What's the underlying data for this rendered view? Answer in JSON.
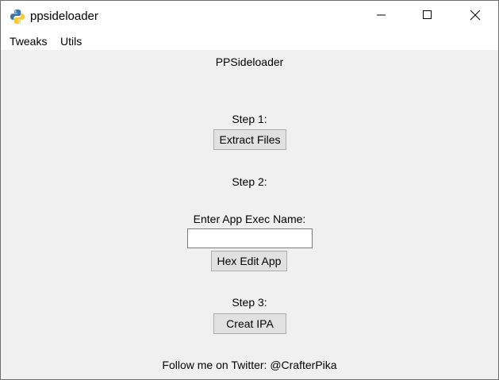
{
  "window": {
    "title": "ppsideloader"
  },
  "menu": {
    "items": [
      {
        "label": "Tweaks"
      },
      {
        "label": "Utils"
      }
    ]
  },
  "main": {
    "app_label": "PPSideloader",
    "step1_label": "Step 1:",
    "extract_button": "Extract Files",
    "step2_label": "Step 2:",
    "enter_label": "Enter App Exec Name:",
    "exec_name_value": "",
    "hex_button": "Hex Edit App",
    "step3_label": "Step 3:",
    "ipa_button": "Creat IPA",
    "follow_text": "Follow me on Twitter: @CrafterPika"
  },
  "icons": {
    "app": "python-icon",
    "minimize": "minimize-icon",
    "maximize": "maximize-icon",
    "close": "close-icon"
  },
  "colors": {
    "window_bg": "#f0f0f0",
    "button_bg": "#e1e1e1",
    "button_border": "#adadad"
  }
}
